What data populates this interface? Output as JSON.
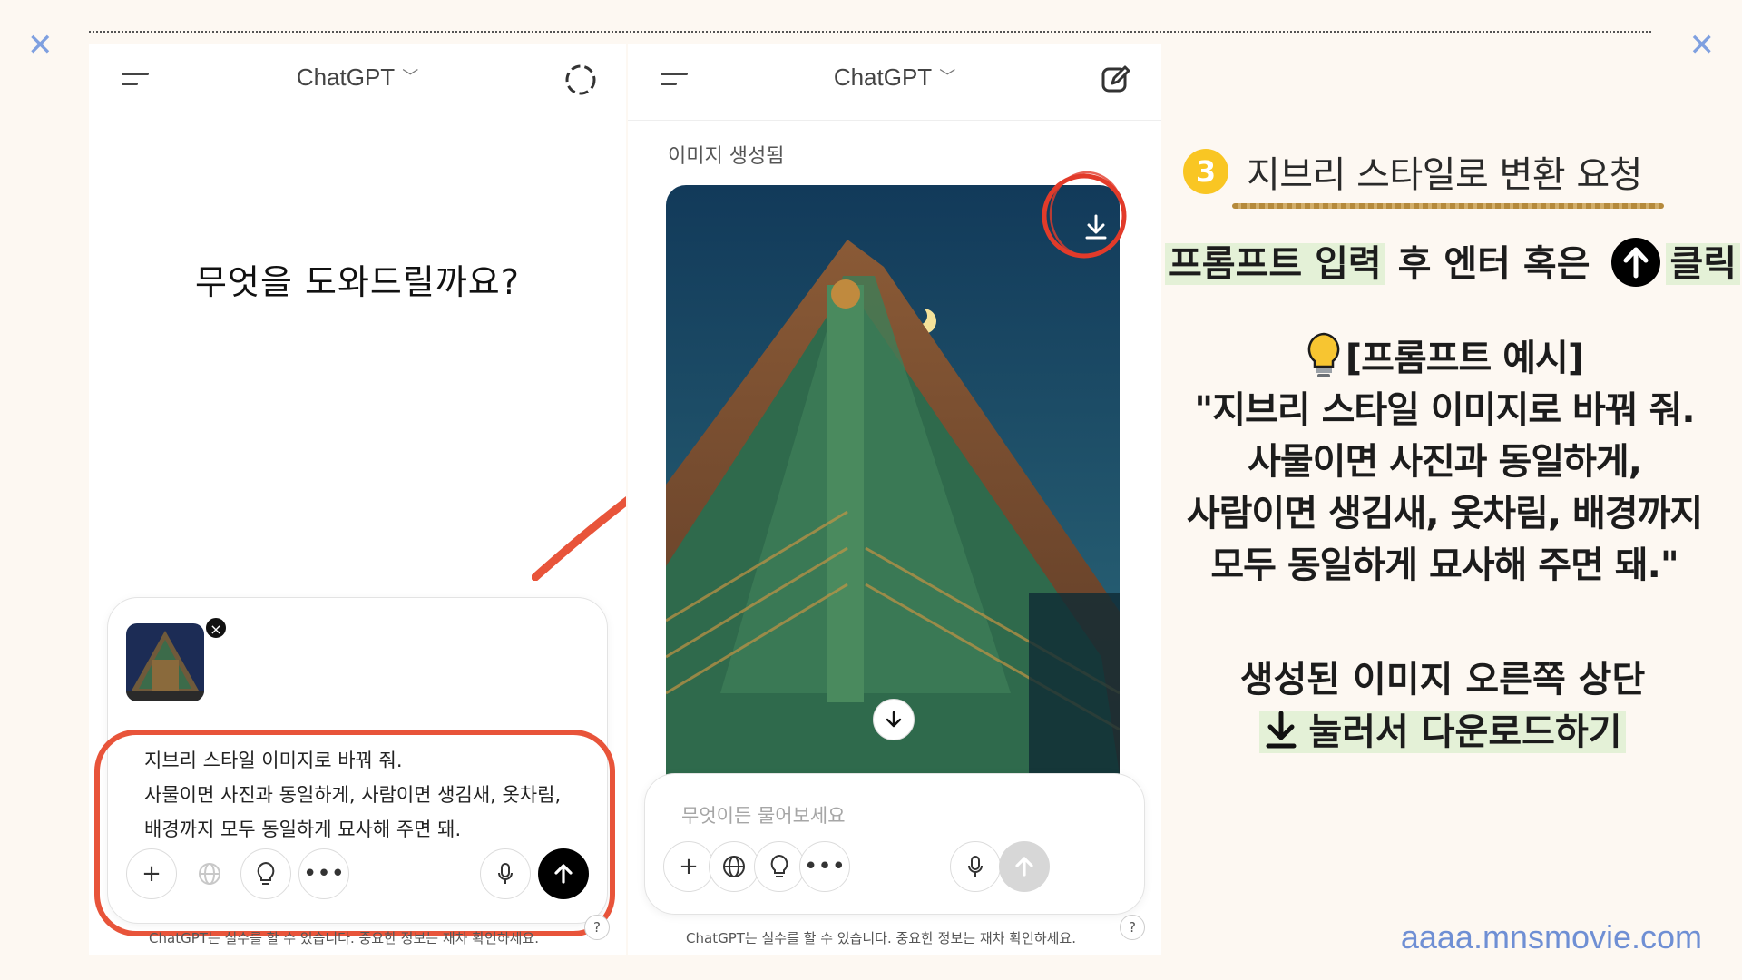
{
  "left_phone": {
    "header_title": "ChatGPT",
    "greeting": "무엇을 도와드릴까요?",
    "prompt_lines": [
      "지브리 스타일 이미지로 바꿔 줘.",
      "사물이면 사진과 동일하게, 사람이면 생김새, 옷차림,",
      "배경까지 모두 동일하게 묘사해 주면 돼."
    ],
    "footnote": "ChatGPT는 실수를 할 수 있습니다. 중요한 정보는 재차 확인하세요.",
    "help": "?",
    "thumb_close": "×"
  },
  "right_phone": {
    "header_title": "ChatGPT",
    "generated_label": "이미지 생성됨",
    "placeholder": "무엇이든 물어보세요",
    "footnote": "ChatGPT는 실수를 할 수 있습니다. 중요한 정보는 재차 확인하세요.",
    "help": "?"
  },
  "instructions": {
    "step_number": "3",
    "step_title": "지브리 스타일로 변환 요청",
    "line1_highlight": "프롬프트 입력",
    "line1_middle": " 후 엔터 혹은 ",
    "line1_end": "클릭",
    "example_header": "[프롬프트 예시]",
    "example_lines": [
      "\"지브리 스타일 이미지로 바꿔 줘.",
      "사물이면 사진과 동일하게,",
      "사람이면 생김새, 옷차림, 배경까지",
      "모두 동일하게 묘사해 주면 돼.\""
    ],
    "bottom_line1": "생성된 이미지 오른쪽 상단",
    "bottom_line2": "눌러서 다운로드하기"
  },
  "website": "aaaa.mnsmovie.com",
  "colors": {
    "accent_red": "#e8543a",
    "badge_yellow": "#f9c623",
    "highlight_green": "#e4f1d7",
    "link_blue": "#6f8fd4"
  }
}
